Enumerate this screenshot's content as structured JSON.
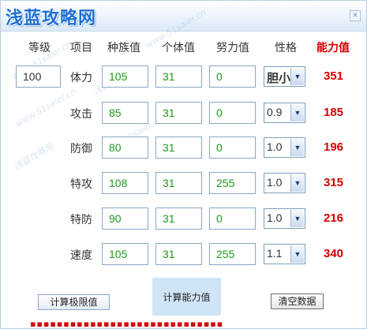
{
  "logo": {
    "text": "浅蓝攻略网",
    "url_text": "www.51saier.cn"
  },
  "headers": {
    "level": "等级",
    "item": "项目",
    "base": "种族值",
    "iv": "个体值",
    "ev": "努力值",
    "nature": "性格",
    "power": "能力值"
  },
  "level": "100",
  "rows": [
    {
      "label": "体力",
      "base": "105",
      "iv": "31",
      "ev": "0",
      "nature": "胆小",
      "power": "351"
    },
    {
      "label": "攻击",
      "base": "85",
      "iv": "31",
      "ev": "0",
      "nature": "0.9",
      "power": "185"
    },
    {
      "label": "防御",
      "base": "80",
      "iv": "31",
      "ev": "0",
      "nature": "1.0",
      "power": "196"
    },
    {
      "label": "特攻",
      "base": "108",
      "iv": "31",
      "ev": "255",
      "nature": "1.0",
      "power": "315"
    },
    {
      "label": "特防",
      "base": "90",
      "iv": "31",
      "ev": "0",
      "nature": "1.0",
      "power": "216"
    },
    {
      "label": "速度",
      "base": "105",
      "iv": "31",
      "ev": "255",
      "nature": "1.1",
      "power": "340"
    }
  ],
  "buttons": {
    "limit": "计算极限值",
    "calc": "计算能力值",
    "clear": "清空数据"
  },
  "colors": {
    "accent_red": "#d40000",
    "value_green": "#1a9a1a",
    "border_blue": "#8aa8c6"
  }
}
